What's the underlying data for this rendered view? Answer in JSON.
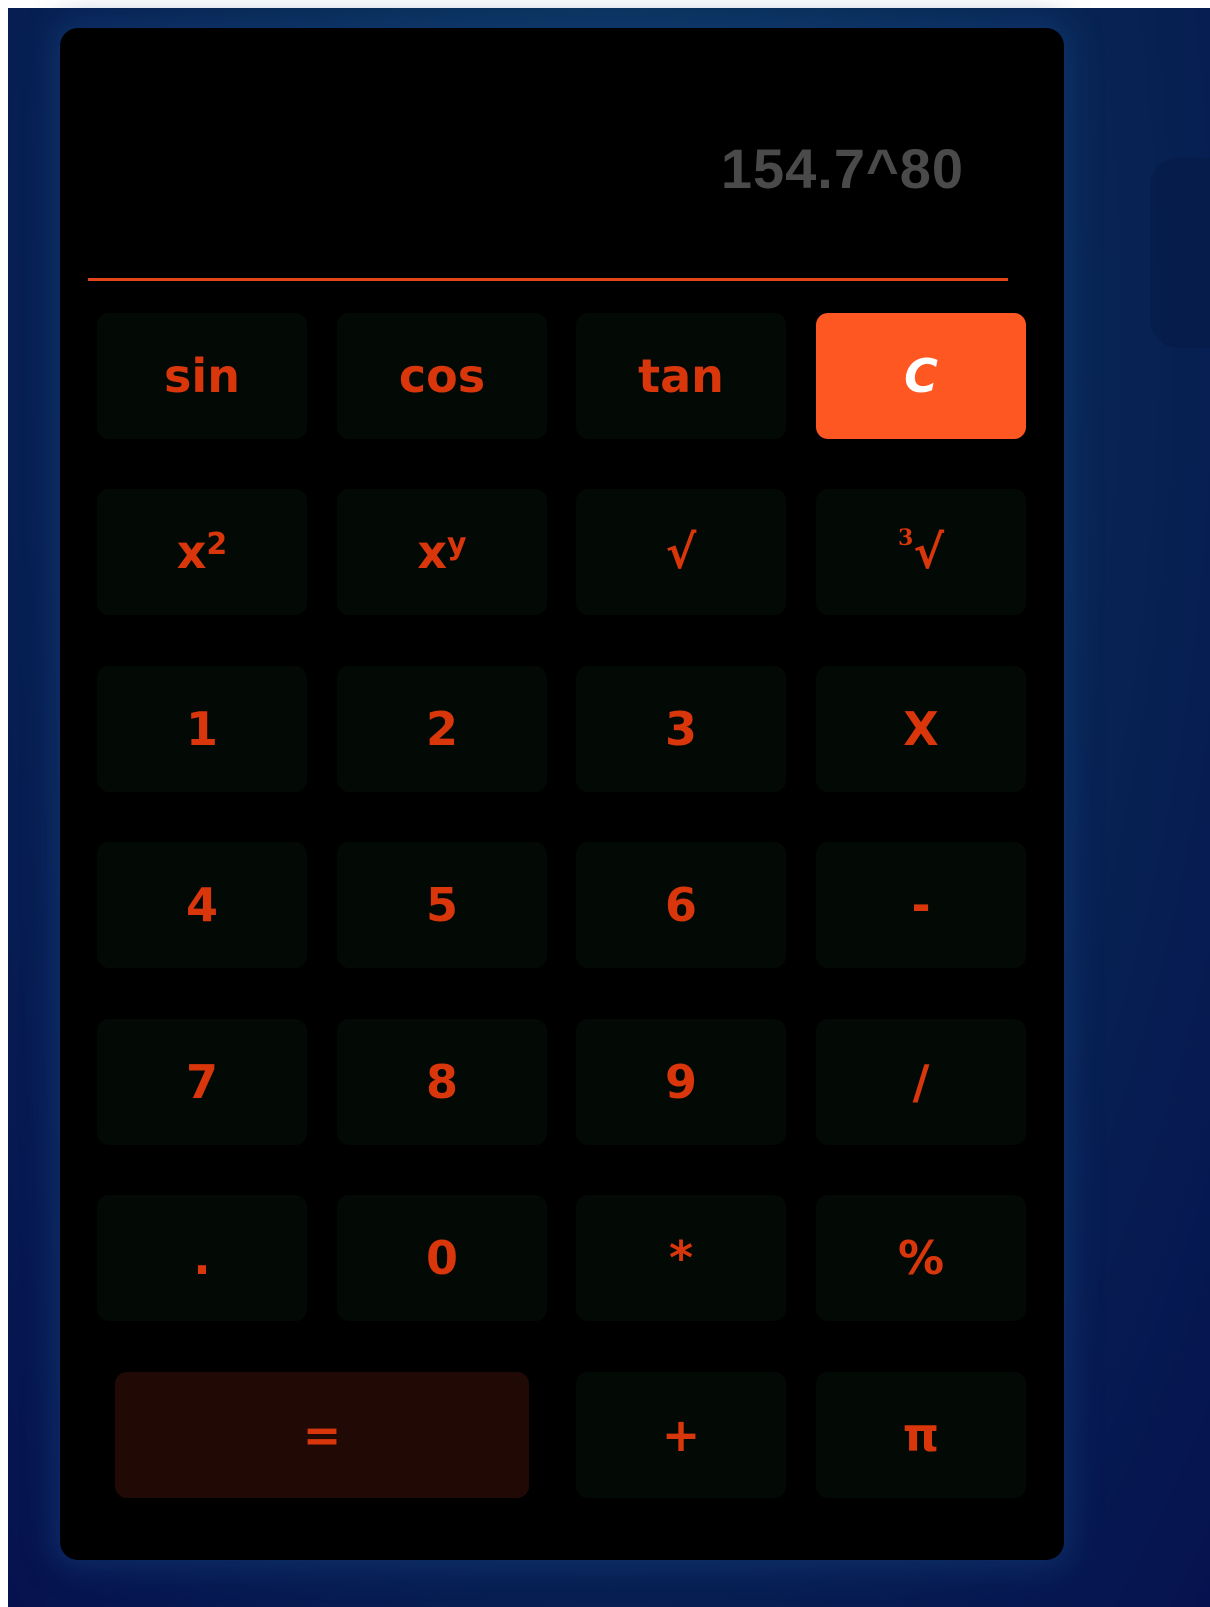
{
  "display": {
    "value": "154.7^80"
  },
  "keys": {
    "sin": "sin",
    "cos": "cos",
    "tan": "tan",
    "clear": "C",
    "square_base": "x",
    "square_exp": "2",
    "power_base": "x",
    "power_exp": "y",
    "sqrt": "√",
    "cbrt_index": "3",
    "cbrt_radical": "√",
    "one": "1",
    "two": "2",
    "three": "3",
    "multiply_x": "X",
    "four": "4",
    "five": "5",
    "six": "6",
    "minus": "-",
    "seven": "7",
    "eight": "8",
    "nine": "9",
    "divide": "/",
    "decimal": ".",
    "zero": "0",
    "asterisk": "*",
    "percent": "%",
    "equals": "=",
    "plus": "+",
    "pi": "π"
  },
  "colors": {
    "key_text": "#d9360b",
    "clear_bg": "#ff5722",
    "display_text": "#4a4a4a",
    "divider": "#e0461a",
    "background": "#06124f"
  }
}
